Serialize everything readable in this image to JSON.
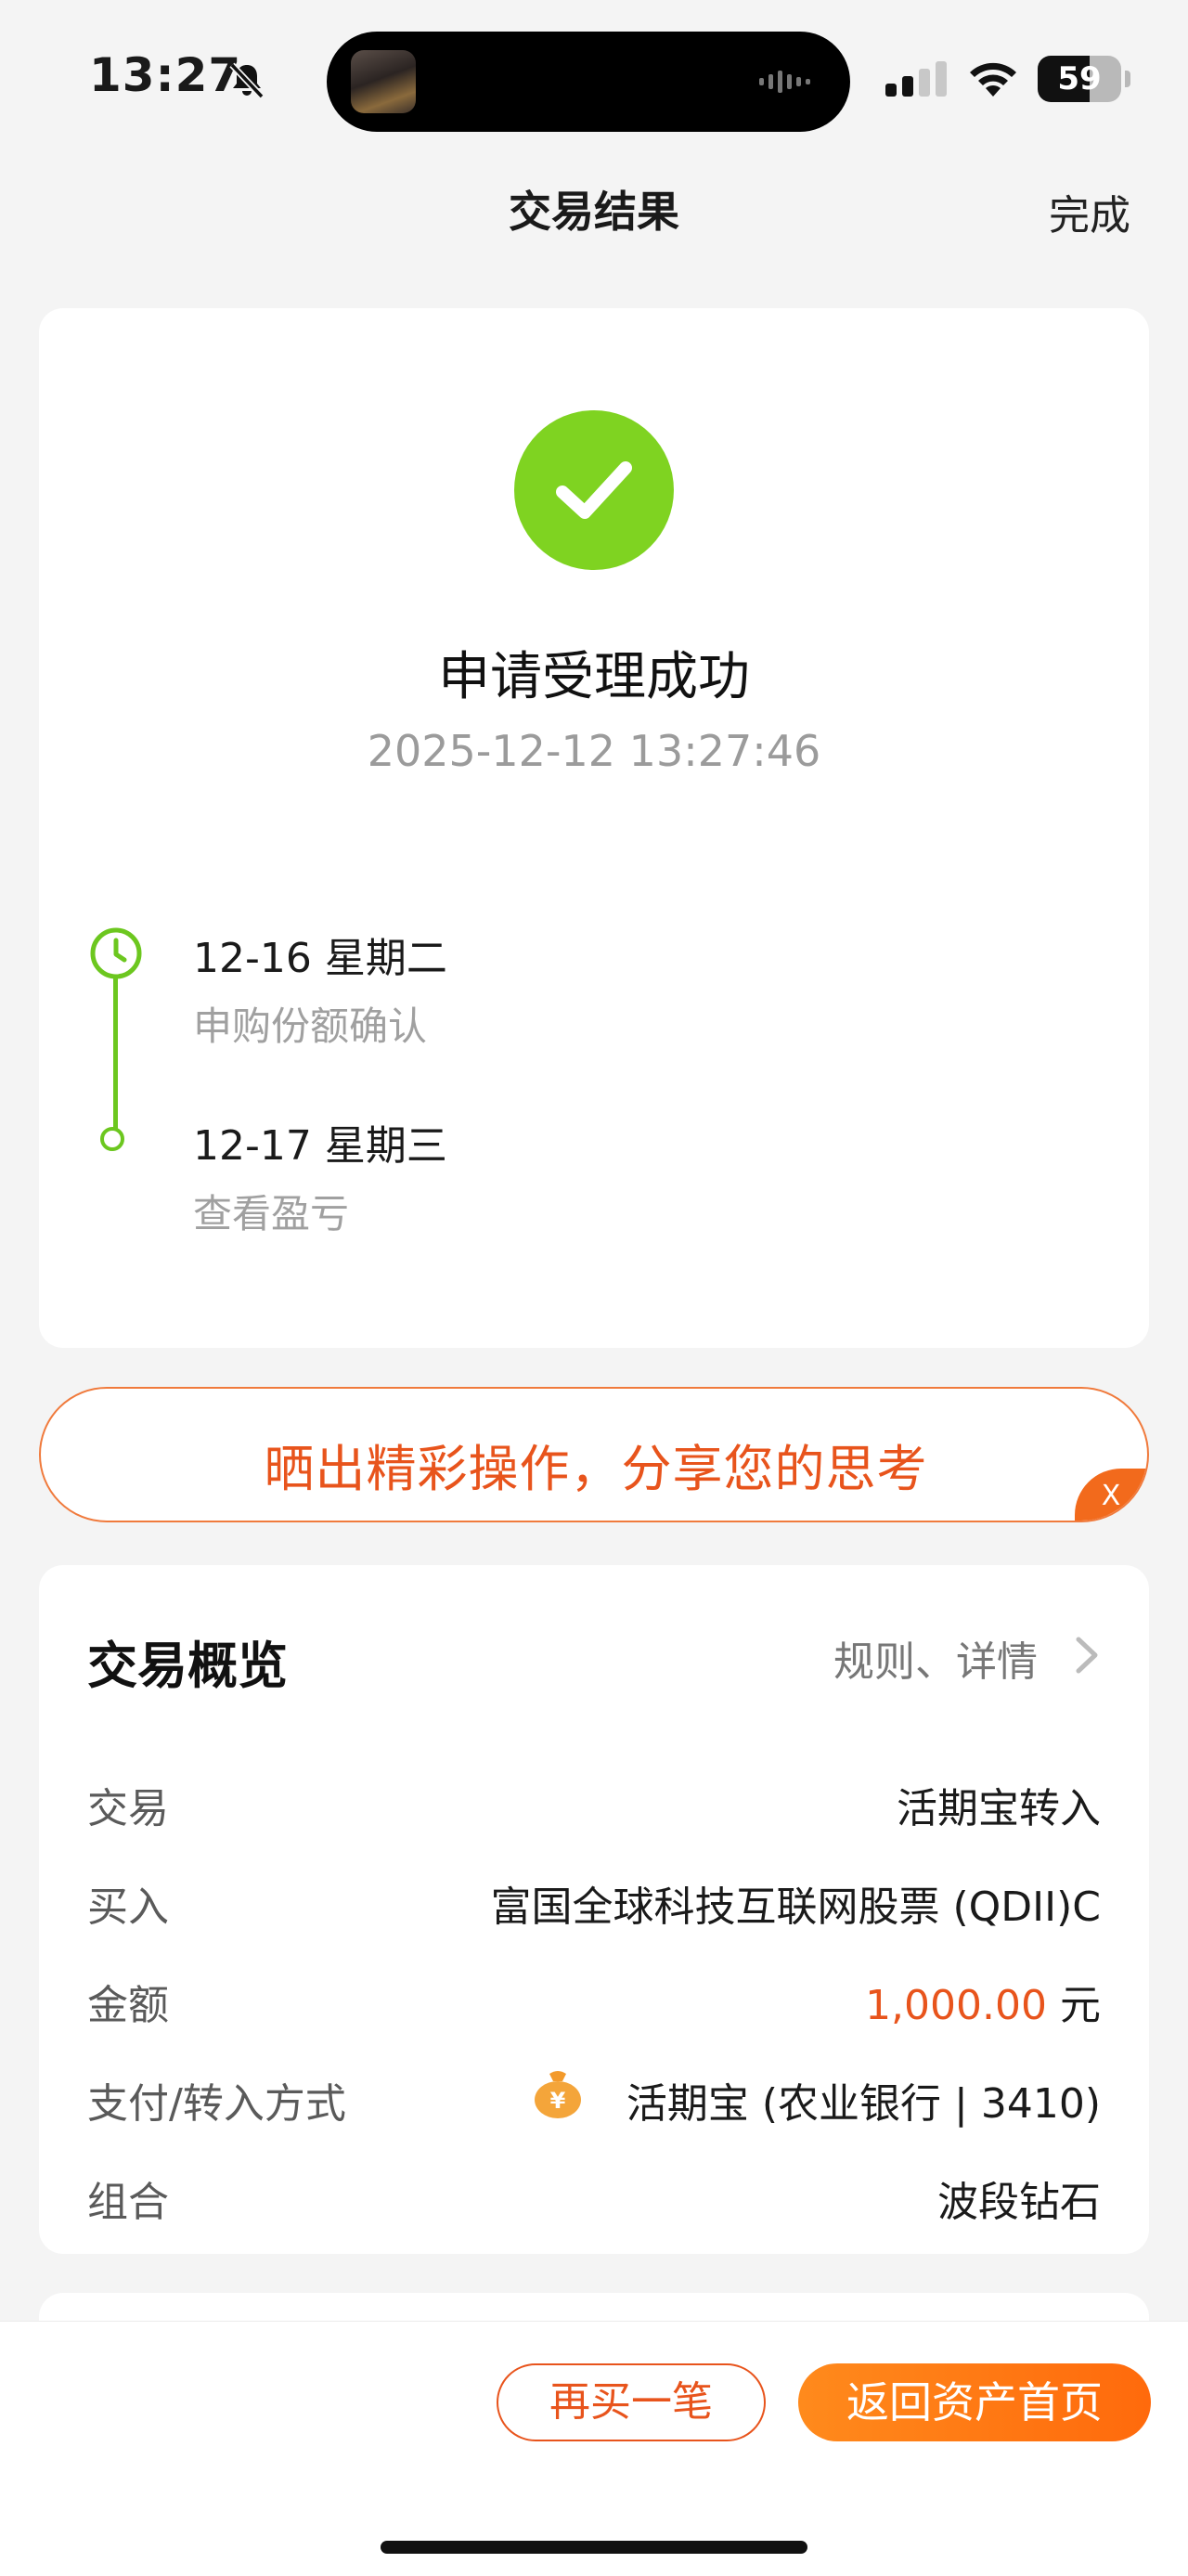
{
  "status_bar": {
    "time": "13:27",
    "battery": "59",
    "icons": [
      "bell-muted-icon",
      "signal-icon",
      "wifi-icon",
      "battery-icon"
    ]
  },
  "nav": {
    "title": "交易结果",
    "done": "完成"
  },
  "result": {
    "icon": "check-circle-icon",
    "title": "申请受理成功",
    "time": "2025-12-12 13:27:46",
    "steps": [
      {
        "date": "12-16  星期二",
        "desc": "申购份额确认"
      },
      {
        "date": "12-17  星期三",
        "desc": "查看盈亏"
      }
    ]
  },
  "share_banner": {
    "text": "晒出精彩操作，分享您的思考",
    "close": "X"
  },
  "overview": {
    "title": "交易概览",
    "link": "规则、详情",
    "rows": [
      {
        "label": "交易",
        "value": "活期宝转入"
      },
      {
        "label": "买入",
        "value": "富国全球科技互联网股票 (QDII)C"
      },
      {
        "label": "金额",
        "amount": "1,000.00",
        "unit": "元"
      },
      {
        "label": "支付/转入方式",
        "value": "活期宝 (农业银行 | 3410)",
        "icon": "money-bag-icon"
      },
      {
        "label": "组合",
        "value": "波段钻石"
      }
    ]
  },
  "bottom": {
    "buy_again": "再买一笔",
    "home": "返回资产首页"
  },
  "colors": {
    "accent": "#e8541c",
    "success": "#7fd321",
    "timeline": "#6cc71f"
  }
}
